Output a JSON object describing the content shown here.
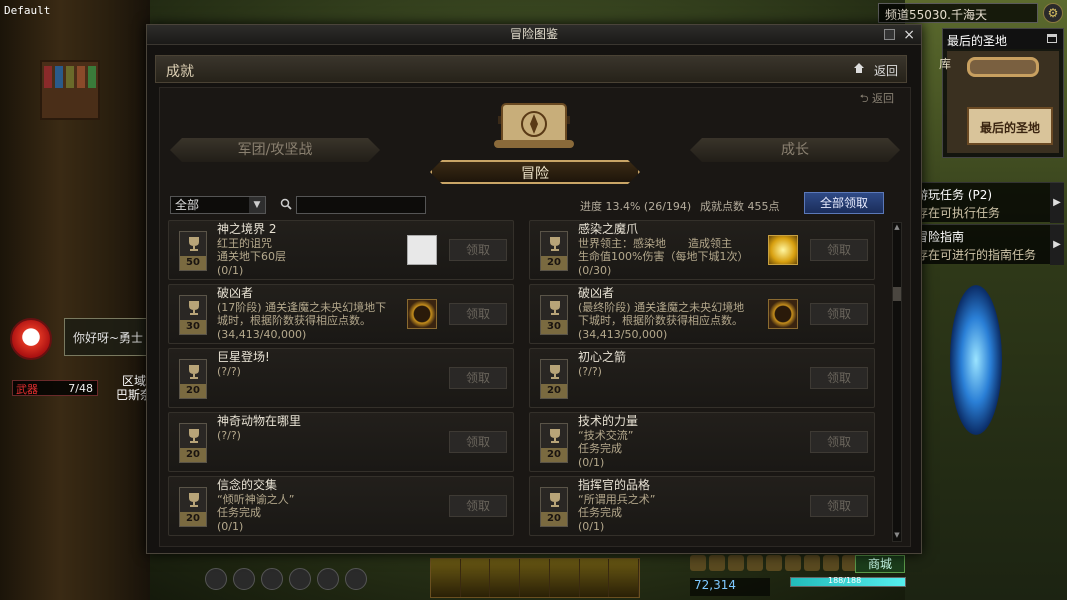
{
  "hud": {
    "default_label": "Default",
    "channel": "频道55030.千海天",
    "minimap": {
      "title": "最后的圣地",
      "location": "最后的圣地",
      "left_text": "库"
    },
    "quests": [
      {
        "title": "游玩任务 (P2)",
        "subtitle": "存在可执行任务"
      },
      {
        "title": "冒险指南",
        "subtitle": "存在可进行的指南任务"
      }
    ],
    "chat_bubble": "你好呀~勇士",
    "weapon_label": "武器",
    "weapon_count": "7/48",
    "side_texts": [
      "区域",
      "巴斯奈"
    ],
    "gold": "72,314",
    "hp_text": "188/188",
    "shop_label": "商城"
  },
  "window": {
    "title": "冒险图鉴",
    "header_title": "成就",
    "back_label": "返回",
    "sub_back_label": "返回",
    "tabs": {
      "left": "军团/攻坚战",
      "center": "冒险",
      "right": "成长"
    },
    "filter": {
      "selected": "全部"
    },
    "search": {
      "placeholder": ""
    },
    "progress_label": "进度 13.4% (26/194)",
    "points_label": "成就点数 455点",
    "claim_all_label": "全部领取"
  },
  "achievements": [
    {
      "title": "神之境界 2",
      "desc": "红王的诅咒\n通关地下60层",
      "progress": "(0/1)",
      "points": "50",
      "reward": "scroll",
      "claim": "领取"
    },
    {
      "title": "感染之魔爪",
      "desc": "世界领主：感染地　　造成领主\n生命值100%伤害（每地下城1次）",
      "progress": "(0/30)",
      "points": "20",
      "reward": "gold-star",
      "claim": "领取"
    },
    {
      "title": "破凶者",
      "desc": "(17阶段) 通关逢魔之未央幻境地下\n城时，根据阶数获得相应点数。",
      "progress": "(34,413/40,000)",
      "points": "30",
      "reward": "emblem",
      "claim": "领取"
    },
    {
      "title": "破凶者",
      "desc": "(最终阶段) 通关逢魔之未央幻境地\n下城时，根据阶数获得相应点数。",
      "progress": "(34,413/50,000)",
      "points": "30",
      "reward": "emblem",
      "claim": "领取"
    },
    {
      "title": "巨星登场!",
      "desc": "",
      "progress": "(?/?)",
      "points": "20",
      "reward": "",
      "claim": "领取"
    },
    {
      "title": "初心之箭",
      "desc": "",
      "progress": "(?/?)",
      "points": "20",
      "reward": "",
      "claim": "领取"
    },
    {
      "title": "神奇动物在哪里",
      "desc": "",
      "progress": "(?/?)",
      "points": "20",
      "reward": "",
      "claim": "领取"
    },
    {
      "title": "技术的力量",
      "desc": "“技术交流”\n任务完成",
      "progress": "(0/1)",
      "points": "20",
      "reward": "",
      "claim": "领取"
    },
    {
      "title": "信念的交集",
      "desc": "“倾听神谕之人”\n任务完成",
      "progress": "(0/1)",
      "points": "20",
      "reward": "",
      "claim": "领取"
    },
    {
      "title": "指挥官的品格",
      "desc": "“所谓用兵之术”\n任务完成",
      "progress": "(0/1)",
      "points": "20",
      "reward": "",
      "claim": "领取"
    }
  ]
}
